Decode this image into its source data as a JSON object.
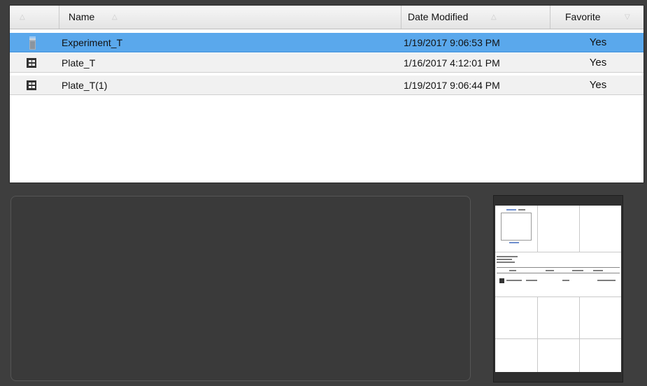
{
  "file_list": {
    "columns": {
      "icon": "",
      "name": "Name",
      "date_modified": "Date Modified",
      "favorite": "Favorite"
    },
    "sort_glyph_up": "△",
    "sort_glyph_down": "▽",
    "rows": [
      {
        "icon": "experiment-icon",
        "name": "Experiment_T",
        "date_modified": "1/19/2017 9:06:53 PM",
        "favorite": "Yes",
        "selected": true
      },
      {
        "icon": "plate-icon",
        "name": "Plate_T",
        "date_modified": "1/16/2017 4:12:01 PM",
        "favorite": "Yes",
        "selected": false
      },
      {
        "icon": "plate-icon",
        "name": "Plate_T(1)",
        "date_modified": "1/19/2017 9:06:44 PM",
        "favorite": "Yes",
        "selected": false
      }
    ]
  },
  "colors": {
    "background": "#3e3e3e",
    "selection": "#5aa8ec",
    "panel": "#3a3a3a"
  }
}
